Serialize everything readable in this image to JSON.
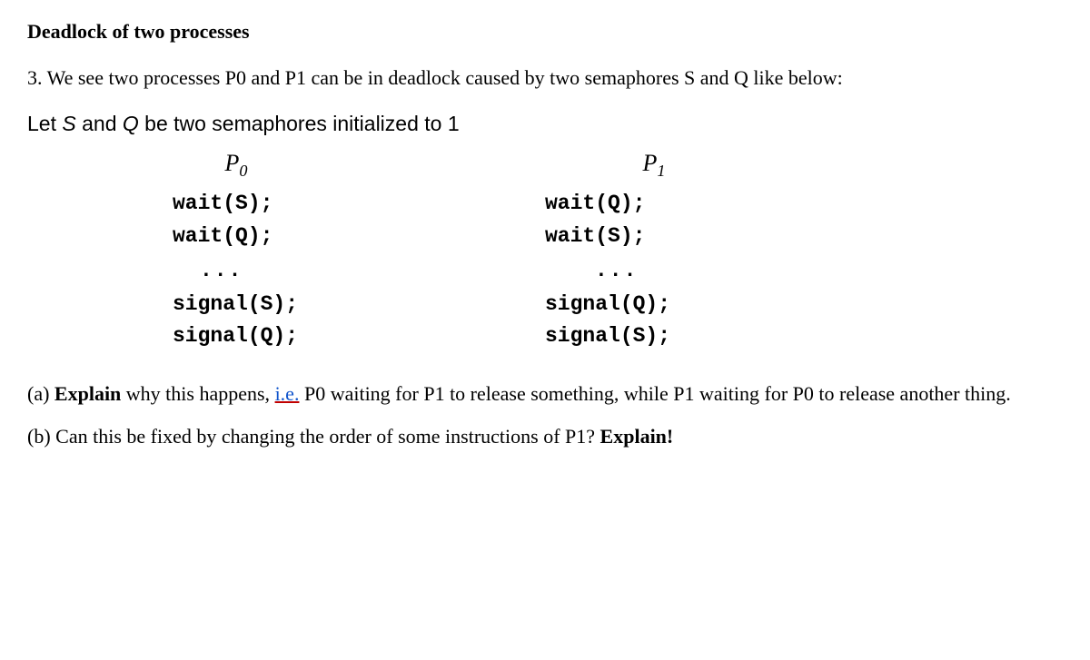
{
  "heading": "Deadlock of two processes",
  "question_intro": "3.  We see two processes P0 and P1 can be in deadlock caused by two semaphores S and Q like below:",
  "let_pre": "Let ",
  "let_s": "S",
  "let_and": " and  ",
  "let_q": "Q",
  "let_post": "  be two semaphores initialized to 1",
  "p0": {
    "label_base": "P",
    "label_sub": "0",
    "l1": "wait(S);",
    "l2": "wait(Q);",
    "l3": "...",
    "l4": "signal(S);",
    "l5": "signal(Q);"
  },
  "p1": {
    "label_base": "P",
    "label_sub": "1",
    "l1": "wait(Q);",
    "l2": "wait(S);",
    "l3": "...",
    "l4": "signal(Q);",
    "l5": "signal(S);"
  },
  "part_a_pre": "(a) ",
  "part_a_bold": "Explain",
  "part_a_mid": " why this happens, ",
  "part_a_ie": "i.e.",
  "part_a_post": " P0 waiting for P1 to release something, while P1 waiting for P0 to release another thing.",
  "part_b_pre": "(b) Can this be fixed by changing the order of some instructions of P1? ",
  "part_b_bold": "Explain!"
}
